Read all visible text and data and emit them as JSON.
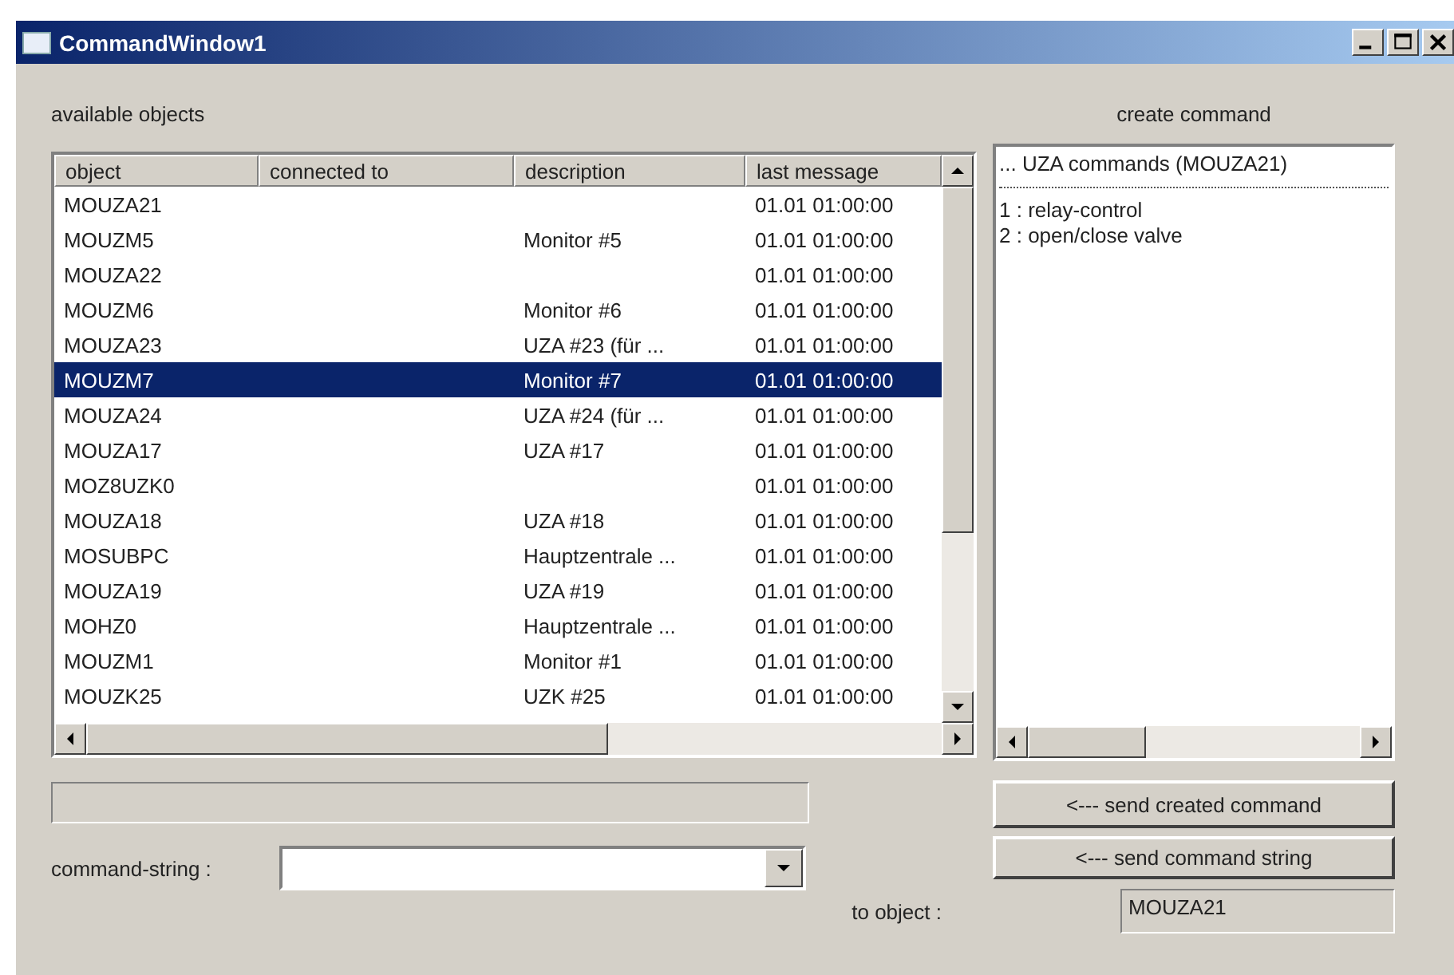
{
  "window": {
    "title": "CommandWindow1"
  },
  "objects": {
    "label": "available objects",
    "columns": [
      "object",
      "connected to",
      "description",
      "last message"
    ],
    "rows": [
      {
        "object": "MOUZA21",
        "description": "",
        "last_message": "01.01 01:00:00",
        "selected": false
      },
      {
        "object": "MOUZM5",
        "description": "Monitor #5",
        "last_message": "01.01 01:00:00",
        "selected": false
      },
      {
        "object": "MOUZA22",
        "description": "",
        "last_message": "01.01 01:00:00",
        "selected": false
      },
      {
        "object": "MOUZM6",
        "description": "Monitor #6",
        "last_message": "01.01 01:00:00",
        "selected": false
      },
      {
        "object": "MOUZA23",
        "description": "UZA #23 (für ...",
        "last_message": "01.01 01:00:00",
        "selected": false
      },
      {
        "object": "MOUZM7",
        "description": "Monitor #7",
        "last_message": "01.01 01:00:00",
        "selected": true
      },
      {
        "object": "MOUZA24",
        "description": "UZA #24 (für ...",
        "last_message": "01.01 01:00:00",
        "selected": false
      },
      {
        "object": "MOUZA17",
        "description": "UZA #17",
        "last_message": "01.01 01:00:00",
        "selected": false
      },
      {
        "object": "MOZ8UZK0",
        "description": "",
        "last_message": "01.01 01:00:00",
        "selected": false
      },
      {
        "object": "MOUZA18",
        "description": "UZA #18",
        "last_message": "01.01 01:00:00",
        "selected": false
      },
      {
        "object": "MOSUBPC",
        "description": "Hauptzentrale ...",
        "last_message": "01.01 01:00:00",
        "selected": false
      },
      {
        "object": "MOUZA19",
        "description": "UZA #19",
        "last_message": "01.01 01:00:00",
        "selected": false
      },
      {
        "object": "MOHZ0",
        "description": "Hauptzentrale ...",
        "last_message": "01.01 01:00:00",
        "selected": false
      },
      {
        "object": "MOUZM1",
        "description": "Monitor #1",
        "last_message": "01.01 01:00:00",
        "selected": false
      },
      {
        "object": "MOUZK25",
        "description": "UZK #25",
        "last_message": "01.01 01:00:00",
        "selected": false
      }
    ]
  },
  "command_string": {
    "label": "command-string :"
  },
  "to_object": {
    "label": "to object :",
    "value": "MOUZA21"
  },
  "create": {
    "label": "create command",
    "header": "... UZA commands (MOUZA21)",
    "items": [
      "1 : relay-control",
      "2 : open/close valve"
    ]
  },
  "buttons": [
    "<--- send created command",
    "<--- send command string"
  ]
}
